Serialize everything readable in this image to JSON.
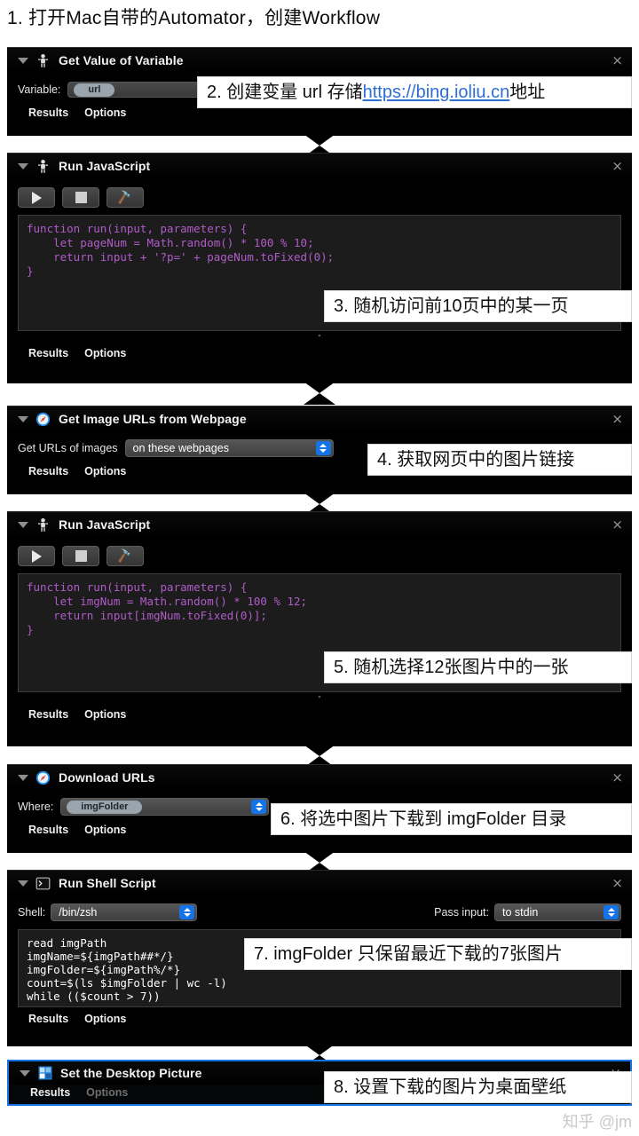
{
  "heading": "1. 打开Mac自带的Automator，创建Workflow",
  "watermark": "知乎 @jm",
  "actions": [
    {
      "title": "Get Value of Variable",
      "icon": "robot-icon",
      "close": "×",
      "variable_label": "Variable:",
      "variable_token": "url",
      "results_label": "Results",
      "options_label": "Options"
    },
    {
      "title": "Run JavaScript",
      "icon": "robot-icon",
      "close": "×",
      "code": "function run(input, parameters) {\n    let pageNum = Math.random() * 100 % 10;\n    return input + '?p=' + pageNum.toFixed(0);\n}",
      "results_label": "Results",
      "options_label": "Options"
    },
    {
      "title": "Get Image URLs from Webpage",
      "icon": "safari-icon",
      "close": "×",
      "field_label": "Get URLs of images",
      "select_value": "on these webpages",
      "results_label": "Results",
      "options_label": "Options"
    },
    {
      "title": "Run JavaScript",
      "icon": "robot-icon",
      "close": "×",
      "code": "function run(input, parameters) {\n    let imgNum = Math.random() * 100 % 12;\n    return input[imgNum.toFixed(0)];\n}",
      "results_label": "Results",
      "options_label": "Options"
    },
    {
      "title": "Download URLs",
      "icon": "safari-icon",
      "close": "×",
      "field_label": "Where:",
      "token": "imgFolder",
      "results_label": "Results",
      "options_label": "Options"
    },
    {
      "title": "Run Shell Script",
      "icon": "terminal-icon",
      "close": "×",
      "shell_label": "Shell:",
      "shell_value": "/bin/zsh",
      "pass_input_label": "Pass input:",
      "pass_input_value": "to stdin",
      "code": "read imgPath\nimgName=${imgPath##*/}\nimgFolder=${imgPath%/*}\ncount=$(ls $imgFolder | wc -l)\nwhile (($count > 7))",
      "results_label": "Results",
      "options_label": "Options"
    },
    {
      "title": "Set the Desktop Picture",
      "icon": "desktop-picture-icon",
      "close": "×",
      "results_label": "Results",
      "options_label": "Options",
      "selected": true
    }
  ],
  "callouts": [
    {
      "id": 2,
      "prefix": "2. 创建变量 url 存储 ",
      "link": "https://bing.ioliu.cn",
      "suffix": " 地址"
    },
    {
      "id": 3,
      "text": "3. 随机访问前10页中的某一页"
    },
    {
      "id": 4,
      "text": "4. 获取网页中的图片链接"
    },
    {
      "id": 5,
      "text": "5. 随机选择12张图片中的一张"
    },
    {
      "id": 6,
      "text": "6. 将选中图片下载到 imgFolder 目录"
    },
    {
      "id": 7,
      "text": "7. imgFolder 只保留最近下载的7张图片"
    },
    {
      "id": 8,
      "text": "8. 设置下载的图片为桌面壁纸"
    }
  ],
  "toolbar": {
    "run_icon": "play-icon",
    "stop_icon": "stop-icon",
    "build_icon": "hammer-icon"
  },
  "colors": {
    "accent": "#1473e6",
    "panel_bg": "#000000",
    "code_text": "#b05cc8",
    "link": "#2e6fd4"
  }
}
